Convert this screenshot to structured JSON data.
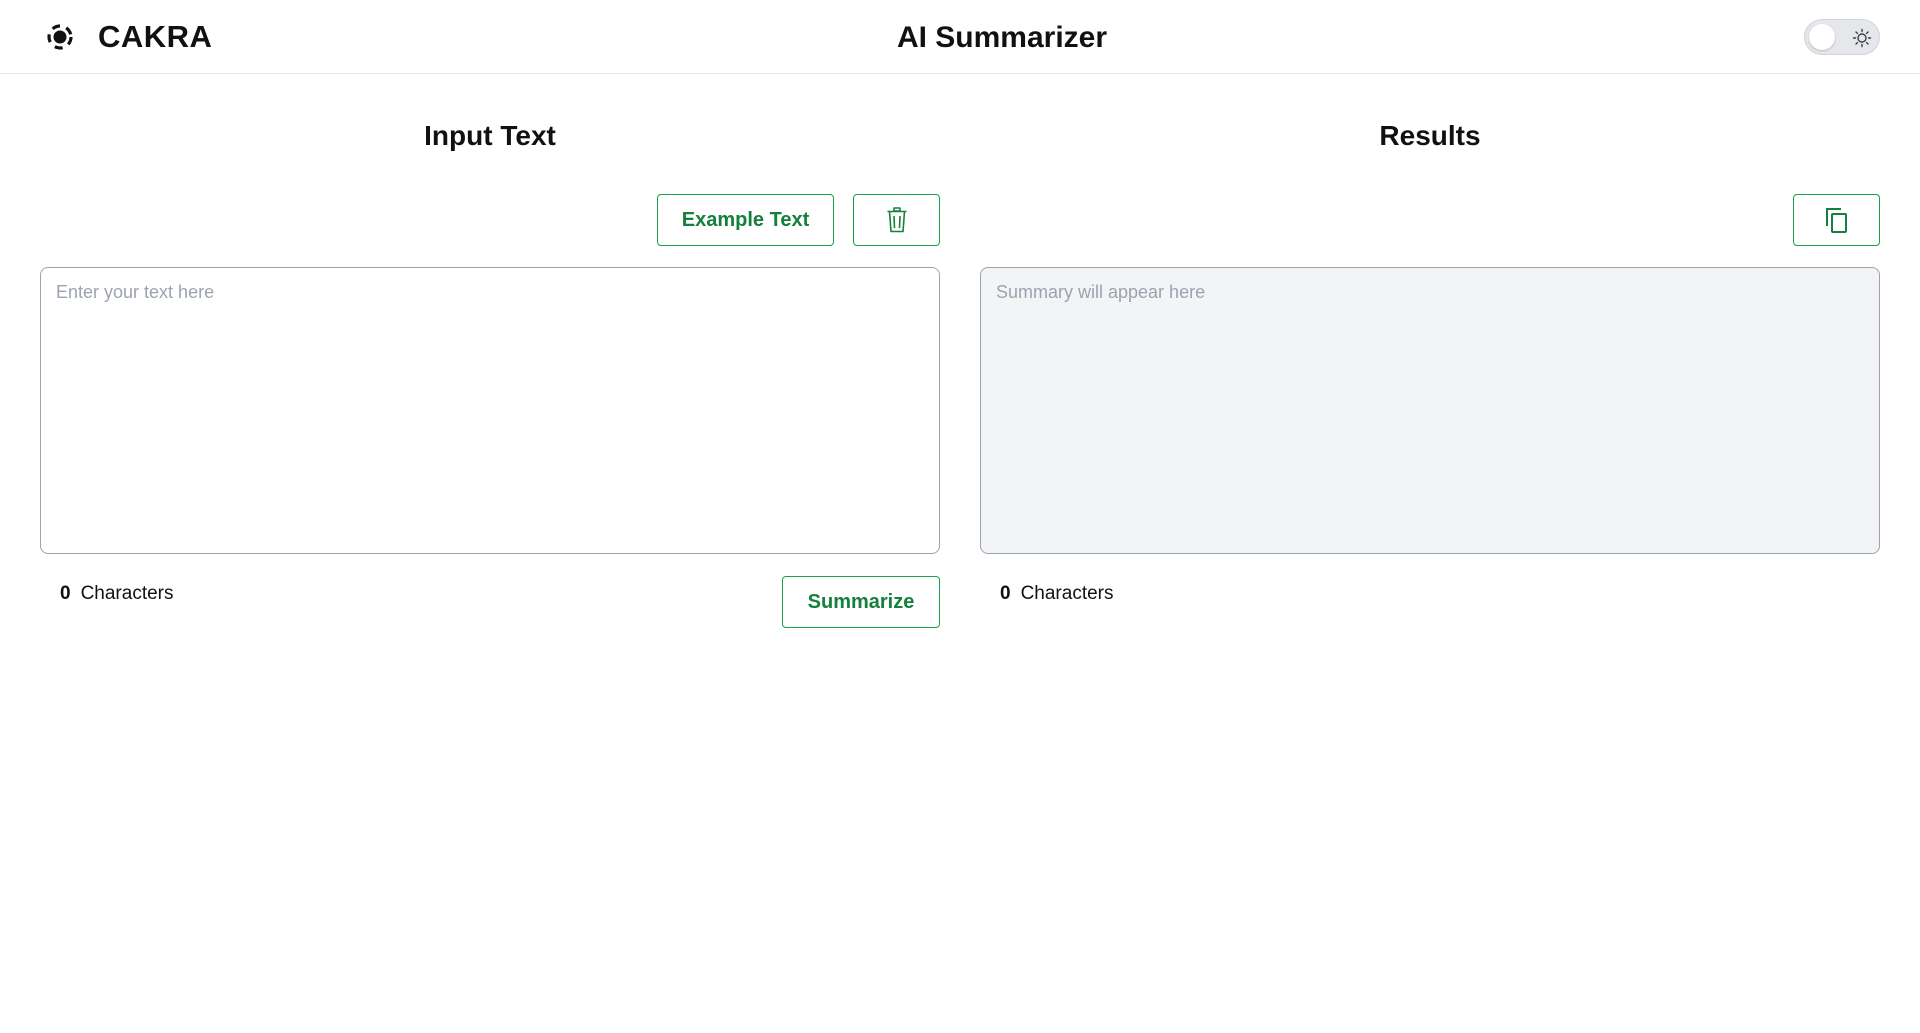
{
  "header": {
    "brand_name": "CAKRA",
    "app_title": "AI Summarizer"
  },
  "input_panel": {
    "title": "Input Text",
    "example_button_label": "Example Text",
    "input_placeholder": "Enter your text here",
    "input_value": "",
    "char_count": "0",
    "char_label": "Characters",
    "summarize_button_label": "Summarize"
  },
  "results_panel": {
    "title": "Results",
    "output_placeholder": "Summary will appear here",
    "output_value": "",
    "char_count": "0",
    "char_label": "Characters"
  },
  "icons": {
    "brand": "cakra-logo-icon",
    "theme": "sun-icon",
    "clear": "trash-icon",
    "copy": "copy-icon"
  },
  "colors": {
    "accent": "#16a34a",
    "accent_text": "#15803d",
    "output_bg": "#f3f4f6",
    "border": "#9ca3af"
  }
}
